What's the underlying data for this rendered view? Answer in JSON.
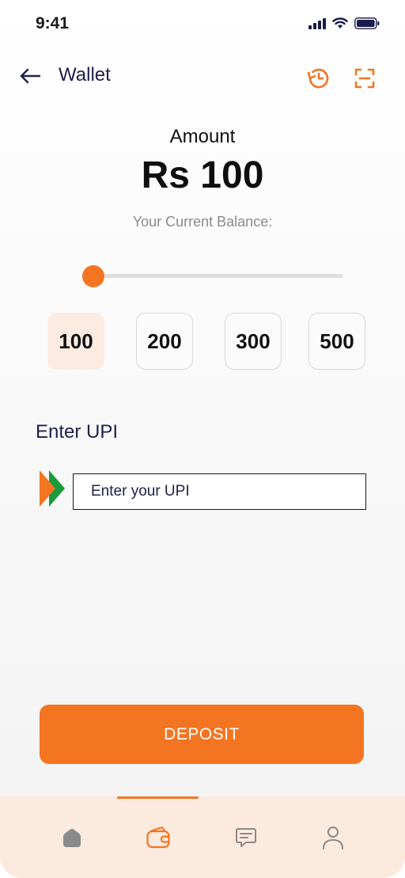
{
  "status_bar": {
    "time": "9:41"
  },
  "header": {
    "title": "Wallet"
  },
  "amount": {
    "label": "Amount",
    "value": "Rs 100",
    "balance_label": "Your Current Balance:",
    "slider_fraction": 0.0
  },
  "presets": [
    {
      "label": "100",
      "selected": true
    },
    {
      "label": "200",
      "selected": false
    },
    {
      "label": "300",
      "selected": false
    },
    {
      "label": "500",
      "selected": false
    }
  ],
  "upi": {
    "label": "Enter UPI",
    "placeholder": "Enter your UPI",
    "value": ""
  },
  "deposit_button": {
    "label": "DEPOSIT"
  },
  "tabs": [
    {
      "icon": "home-icon",
      "active": false
    },
    {
      "icon": "wallet-icon",
      "active": true
    },
    {
      "icon": "chat-icon",
      "active": false
    },
    {
      "icon": "profile-icon",
      "active": false
    }
  ],
  "colors": {
    "accent": "#f47521",
    "accent_light": "#fdeadf",
    "title": "#1f1f4d"
  }
}
